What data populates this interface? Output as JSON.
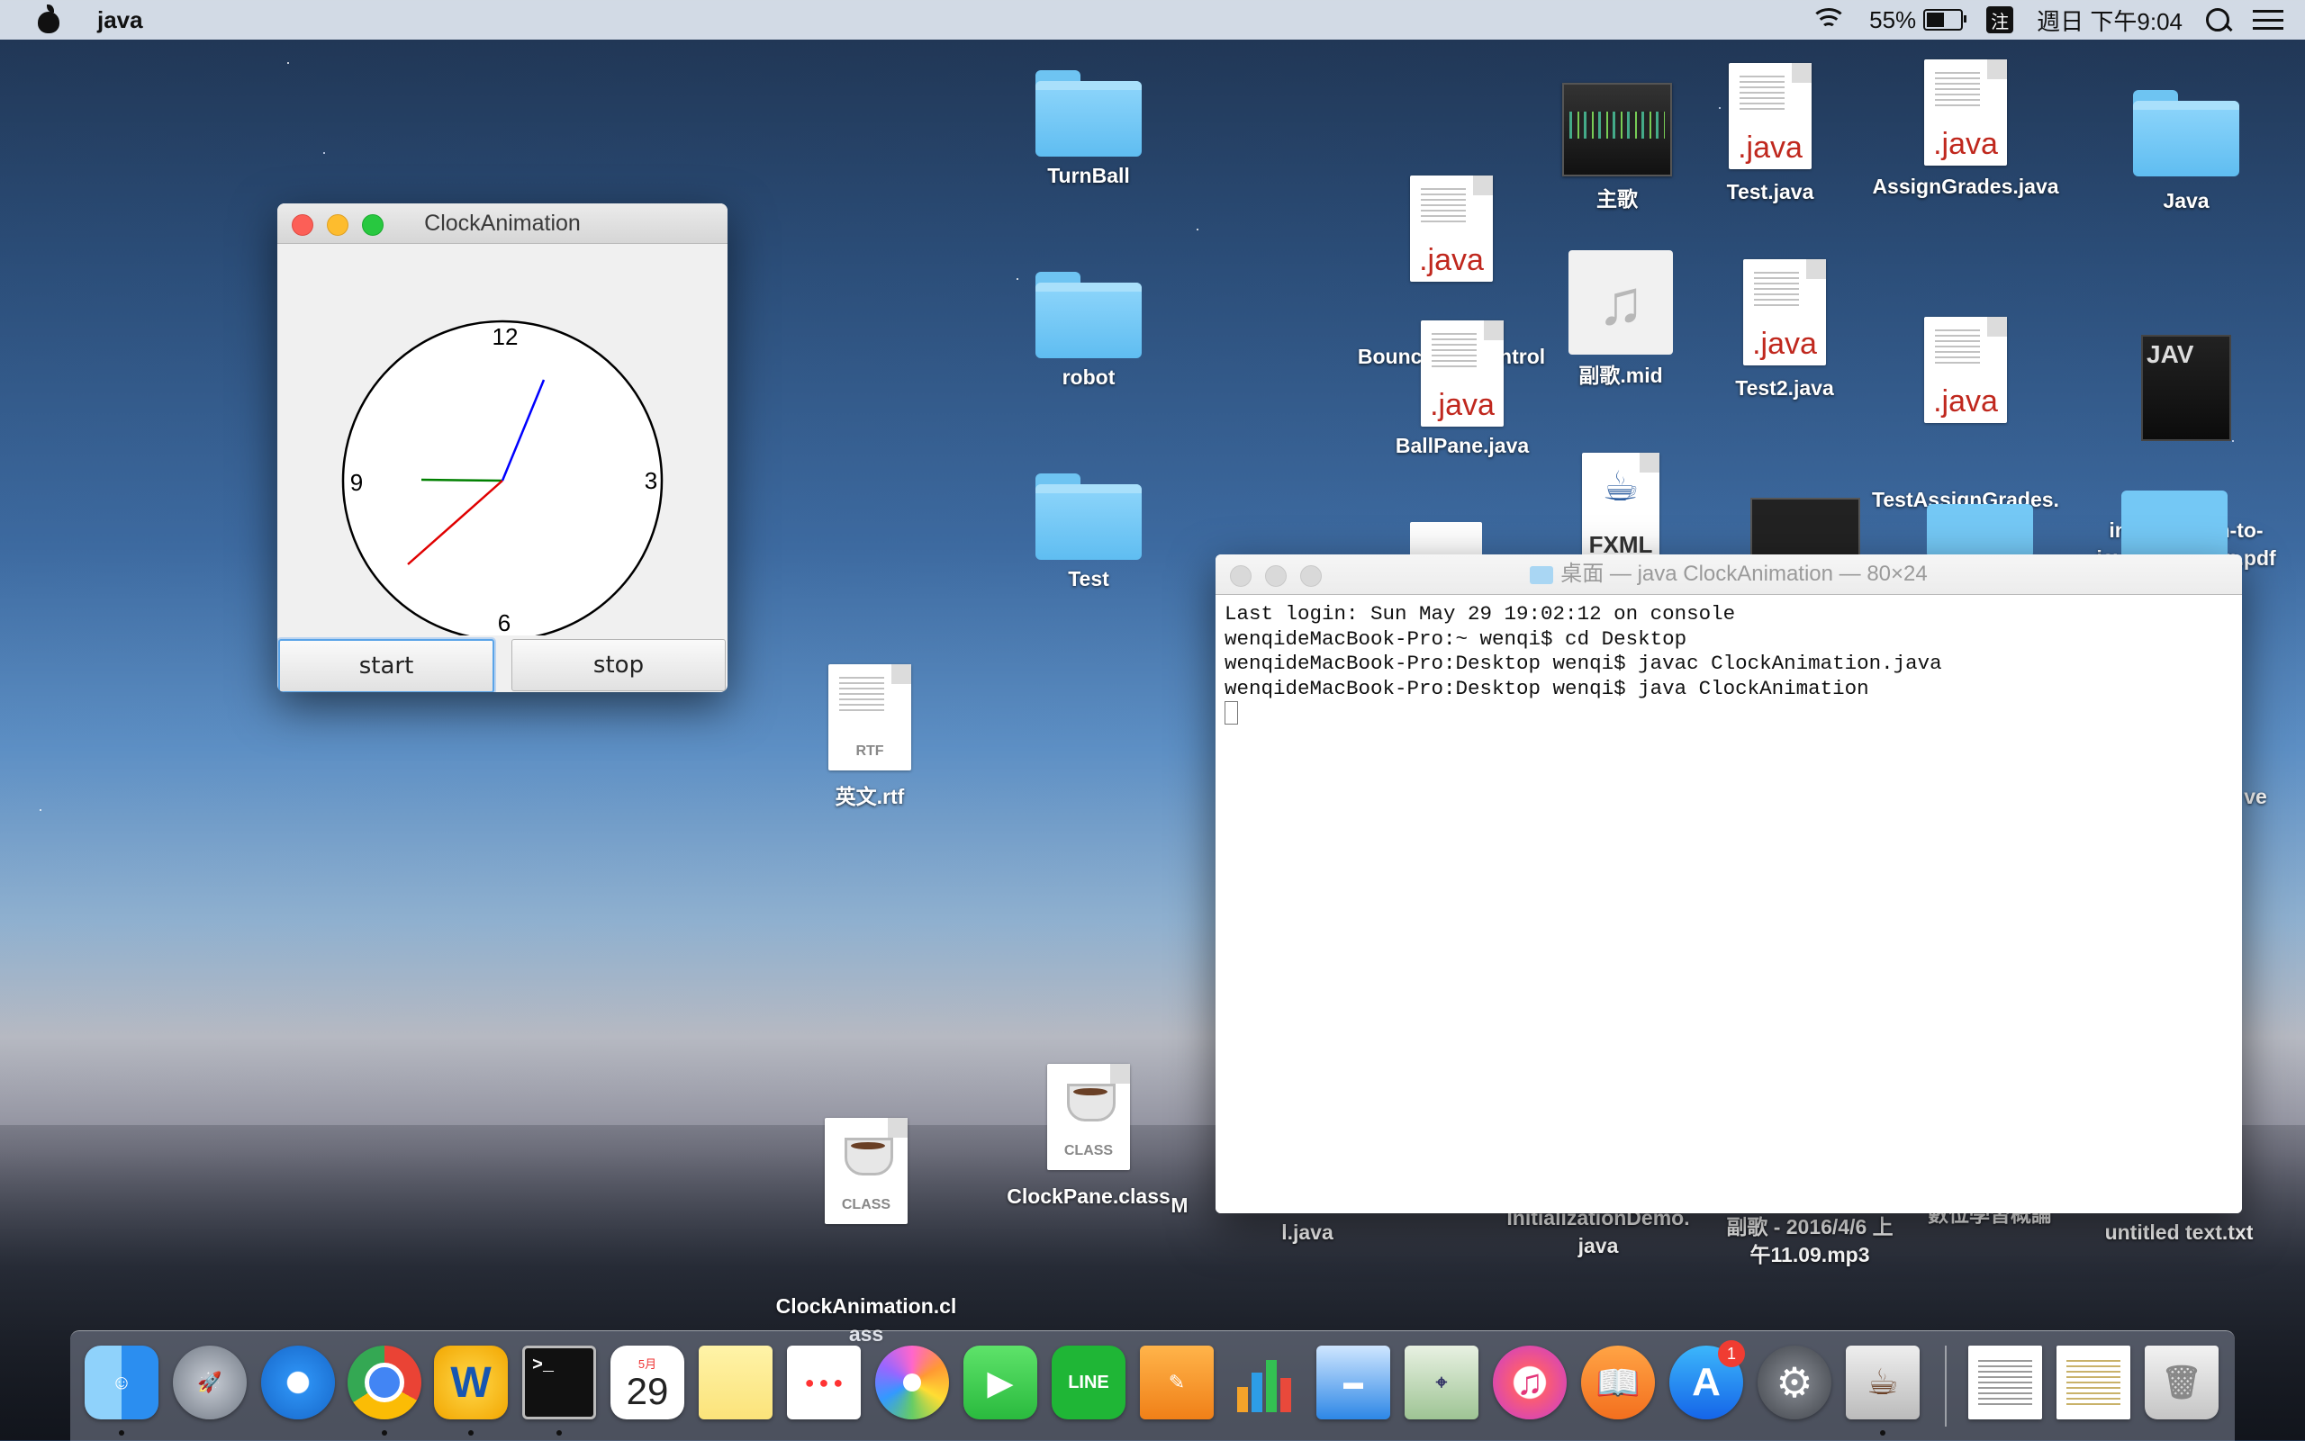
{
  "menubar": {
    "app_name": "java",
    "battery_percent": "55%",
    "battery_level": 0.55,
    "input_method": "注",
    "datetime": "週日 下午9:04"
  },
  "clock_window": {
    "title": "ClockAnimation",
    "numerals": {
      "twelve": "12",
      "three": "3",
      "six": "6",
      "nine": "9"
    },
    "hand_colors": {
      "second": "#e00000",
      "minute": "#0000ff",
      "hour": "#008000"
    },
    "start_label": "start",
    "stop_label": "stop"
  },
  "terminal": {
    "title": "桌面 — java ClockAnimation — 80×24",
    "lines": [
      "Last login: Sun May 29 19:02:12 on console",
      "wenqideMacBook-Pro:~ wenqi$ cd Desktop",
      "wenqideMacBook-Pro:Desktop wenqi$ javac ClockAnimation.java",
      "wenqideMacBook-Pro:Desktop wenqi$ java ClockAnimation"
    ]
  },
  "desktop": {
    "turnball": "TurnBall",
    "robot": "robot",
    "test_folder": "Test",
    "java_folder": "Java",
    "bounceball": "BounceBallControl\n.java",
    "ballpane": "BallPane.java",
    "zhuge": "主歌",
    "fuge_mid": "副歌.mid",
    "fxml": "FXML",
    "test_java": "Test.java",
    "test2_java": "Test2.java",
    "assigngrades": "AssignGrades.java",
    "testassign": "TestAssignGrades.\njava",
    "intro_pdf": "introduction-to-\njava-pro...ition.pdf",
    "yingwen": "英文.rtf",
    "clockanim_class": "ClockAnimation.cl\nass",
    "clockpane_class": "ClockPane.class",
    "partial_m": "M",
    "partial_ljava": "l.java",
    "initdemo": "InitializationDemo.\njava",
    "fuge_mp3": "副歌 - 2016/4/6 上\n午11.09.mp3",
    "shuwei": "數位學習概論",
    "untitled": "untitled text.txt",
    "partial_ve": "ve",
    "java_ext": ".java",
    "rtf_ext": "RTF",
    "class_ext": "CLASS"
  },
  "dock": {
    "calendar_month": "5月",
    "calendar_day": "29",
    "line_label": "LINE",
    "appstore_badge": "1"
  }
}
